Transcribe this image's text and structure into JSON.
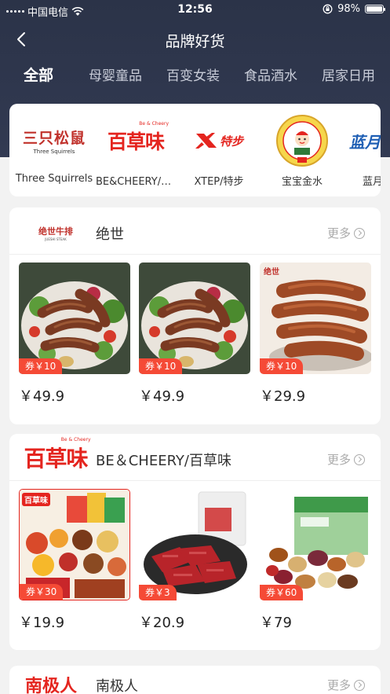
{
  "status_bar": {
    "carrier": "中国电信",
    "time": "12:56",
    "battery": "98%",
    "battery_level": 0.98
  },
  "nav": {
    "title": "品牌好货"
  },
  "categories": [
    {
      "label": "全部",
      "active": true
    },
    {
      "label": "母婴童品",
      "active": false
    },
    {
      "label": "百变女装",
      "active": false
    },
    {
      "label": "食品酒水",
      "active": false
    },
    {
      "label": "居家日用",
      "active": false
    }
  ],
  "brands": [
    {
      "name": "Three Squirrels",
      "logo_text": "三只松鼠",
      "logo_sub": "Three Squirrels"
    },
    {
      "name": "BE&CHEERY/百草味",
      "logo_text": "百草味",
      "logo_sub": "Be & Cheery"
    },
    {
      "name": "XTEP/特步",
      "logo_text": "特步",
      "logo_sub": ""
    },
    {
      "name": "宝宝金水",
      "logo_text": "",
      "logo_sub": ""
    },
    {
      "name": "蓝月亮",
      "logo_text": "蓝月",
      "logo_sub": ""
    }
  ],
  "sections": [
    {
      "name": "绝世",
      "logo_text": "绝世牛排",
      "logo_sub": "JUESHI STEAK",
      "more": "更多",
      "products": [
        {
          "coupon": "券￥10",
          "price": "￥49.9"
        },
        {
          "coupon": "券￥10",
          "price": "￥49.9"
        },
        {
          "coupon": "券￥10",
          "price": "￥29.9",
          "img_label": "绝世"
        }
      ]
    },
    {
      "name": "BE＆CHEERY/百草味",
      "logo_text": "百草味",
      "logo_sub": "Be & Cheery",
      "more": "更多",
      "products": [
        {
          "coupon": "券￥30",
          "price": "￥19.9",
          "img_label": "百草味"
        },
        {
          "coupon": "券￥3",
          "price": "￥20.9"
        },
        {
          "coupon": "券￥60",
          "price": "￥79"
        }
      ]
    },
    {
      "name": "南极人",
      "logo_text": "南极人",
      "more": "更多"
    }
  ],
  "colors": {
    "header": "#2b3348",
    "coupon": "#f54a36",
    "brand_red": "#e4251f"
  }
}
